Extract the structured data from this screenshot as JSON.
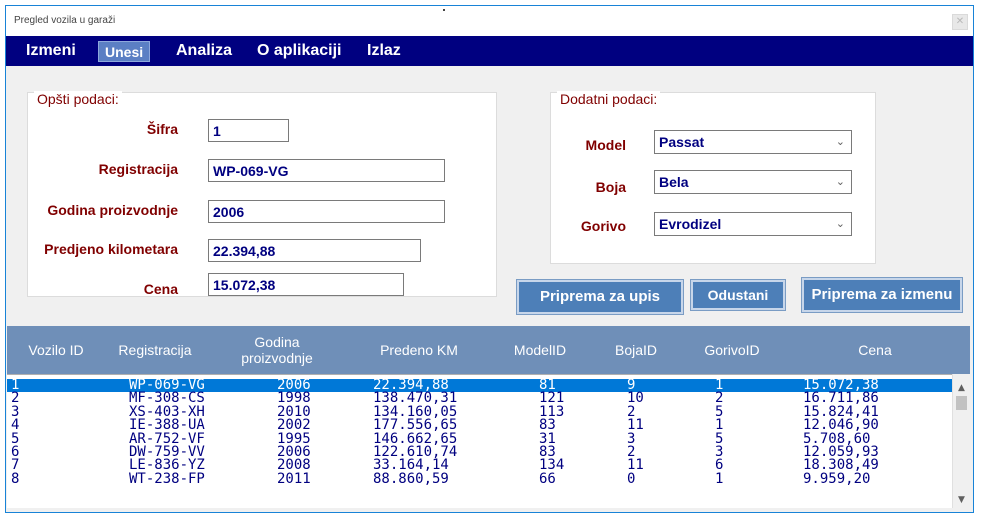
{
  "window": {
    "title": "Pregled vozila u garaži",
    "close_glyph": "✕"
  },
  "menu": {
    "items": [
      "Izmeni",
      "Unesi",
      "Analiza",
      "O aplikaciji",
      "Izlaz"
    ]
  },
  "general": {
    "legend": "Opšti podaci:",
    "sifra_label": "Šifra",
    "sifra_value": "1",
    "registracija_label": "Registracija",
    "registracija_value": "WP-069-VG",
    "godina_label": "Godina proizvodnje",
    "godina_value": "2006",
    "km_label": "Predjeno kilometara",
    "km_value": "22.394,88",
    "cena_label": "Cena",
    "cena_value": "15.072,38"
  },
  "extra": {
    "legend": "Dodatni podaci:",
    "model_label": "Model",
    "model_value": "Passat",
    "boja_label": "Boja",
    "boja_value": "Bela",
    "gorivo_label": "Gorivo",
    "gorivo_value": "Evrodizel"
  },
  "buttons": {
    "priprema_upis": "Priprema za upis",
    "odustani": "Odustani",
    "priprema_izmena": "Priprema za izmenu"
  },
  "grid": {
    "columns": [
      "Vozilo ID",
      "Registracija",
      "Godina proizvodnje",
      "Predeno KM",
      "ModelID",
      "BojaID",
      "GorivoID",
      "Cena"
    ],
    "rows": [
      [
        "1",
        "WP-069-VG",
        "2006",
        "22.394,88",
        "81",
        "9",
        "1",
        "15.072,38"
      ],
      [
        "2",
        "MF-308-CS",
        "1998",
        "138.470,31",
        "121",
        "10",
        "2",
        "16.711,86"
      ],
      [
        "3",
        "XS-403-XH",
        "2010",
        "134.160,05",
        "113",
        "2",
        "5",
        "15.824,41"
      ],
      [
        "4",
        "IE-388-UA",
        "2002",
        "177.556,65",
        "83",
        "11",
        "1",
        "12.046,90"
      ],
      [
        "5",
        "AR-752-VF",
        "1995",
        "146.662,65",
        "31",
        "3",
        "5",
        "5.708,60"
      ],
      [
        "6",
        "DW-759-VV",
        "2006",
        "122.610,74",
        "83",
        "2",
        "3",
        "12.059,93"
      ],
      [
        "7",
        "LE-836-YZ",
        "2008",
        "33.164,14",
        "134",
        "11",
        "6",
        "18.308,49"
      ],
      [
        "8",
        "WT-238-FP",
        "2011",
        "88.860,59",
        "66",
        "0",
        "1",
        "9.959,20"
      ]
    ],
    "selected_row": 0
  },
  "icons": {
    "dropdown": "chevron-down-icon",
    "scroll_up": "scroll-up-icon",
    "scroll_down": "scroll-down-icon"
  },
  "colors": {
    "menubar": "#000080",
    "header": "#6f8fb8",
    "label": "#800000",
    "button": "#4d7fb8",
    "selection": "#0078d7"
  }
}
